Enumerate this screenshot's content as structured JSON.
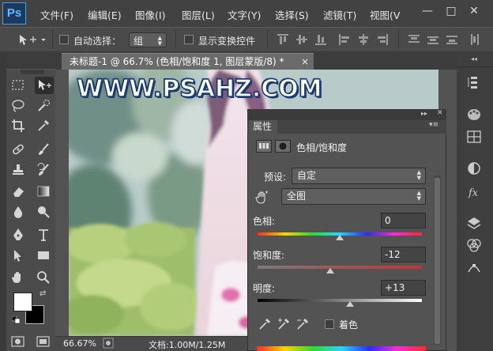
{
  "app": {
    "logo_text": "Ps"
  },
  "menu": [
    "文件(F)",
    "编辑(E)",
    "图像(I)",
    "图层(L)",
    "文字(Y)",
    "选择(S)",
    "滤镜(T)",
    "视图(V"
  ],
  "window_controls": {
    "minimize": "—",
    "restore": "□",
    "close": "✕"
  },
  "options_bar": {
    "auto_select_label": "自动选择：",
    "auto_select_value": "组",
    "show_transform_label": "显示变换控件"
  },
  "document_tab": {
    "title": "未标题-1 @ 66.7% (色相/饱和度 1, 图层蒙版/8) *",
    "close": "×"
  },
  "canvas": {
    "watermark": "WWW.PSAHZ.COM"
  },
  "status_bar": {
    "zoom": "66.67%",
    "doc_info": "文档:1.00M/1.25M"
  },
  "properties_panel": {
    "tab_label": "属性",
    "adjustment_title": "色相/饱和度",
    "preset_label": "预设:",
    "preset_value": "自定",
    "channel_value": "全图",
    "hue_label": "色相:",
    "hue_value": "0",
    "saturation_label": "饱和度:",
    "saturation_value": "-12",
    "lightness_label": "明度:",
    "lightness_value": "+13",
    "colorize_label": "着色"
  },
  "colors": {
    "menubar": "#424242",
    "panel": "#535353",
    "foreground_swatch": "#ffffff",
    "background_swatch": "#000000"
  }
}
